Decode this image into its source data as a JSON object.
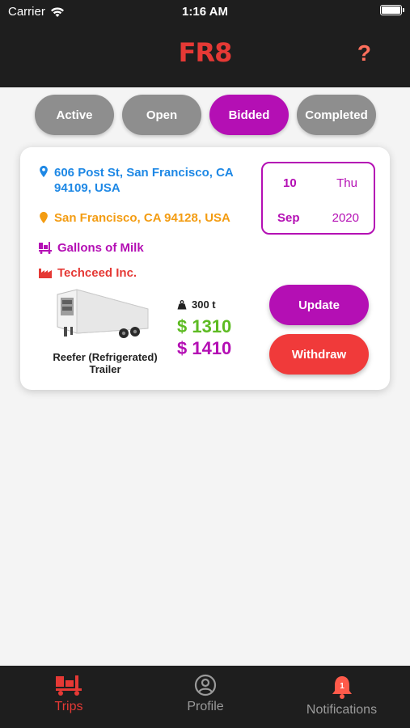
{
  "status_bar": {
    "carrier": "Carrier",
    "time": "1:16 AM"
  },
  "header": {
    "logo": "FR8",
    "help": "?"
  },
  "tabs": [
    {
      "label": "Active",
      "selected": false
    },
    {
      "label": "Open",
      "selected": false
    },
    {
      "label": "Bidded",
      "selected": true
    },
    {
      "label": "Completed",
      "selected": false
    }
  ],
  "trip": {
    "pickup_address": "606 Post St, San Francisco, CA 94109, USA",
    "dropoff_address": "San Francisco, CA 94128, USA",
    "goods": "Gallons of Milk",
    "company": "Techceed Inc.",
    "date": {
      "day": "10",
      "weekday": "Thu",
      "month": "Sep",
      "year": "2020"
    },
    "trailer": "Reefer (Refrigerated) Trailer",
    "weight": "300 t",
    "price_original": "$ 1310",
    "price_bid": "$ 1410",
    "update_label": "Update",
    "withdraw_label": "Withdraw"
  },
  "bottom_nav": [
    {
      "label": "Trips",
      "icon": "truck-icon",
      "active": true
    },
    {
      "label": "Profile",
      "icon": "user-circle-icon",
      "active": false
    },
    {
      "label": "Notifications",
      "icon": "bell-icon",
      "badge": "1",
      "active": false
    }
  ],
  "colors": {
    "accent": "#b40fb4",
    "brand": "#e53935",
    "green": "#5dbb22",
    "blue": "#1e88e5",
    "orange": "#f39c12"
  }
}
